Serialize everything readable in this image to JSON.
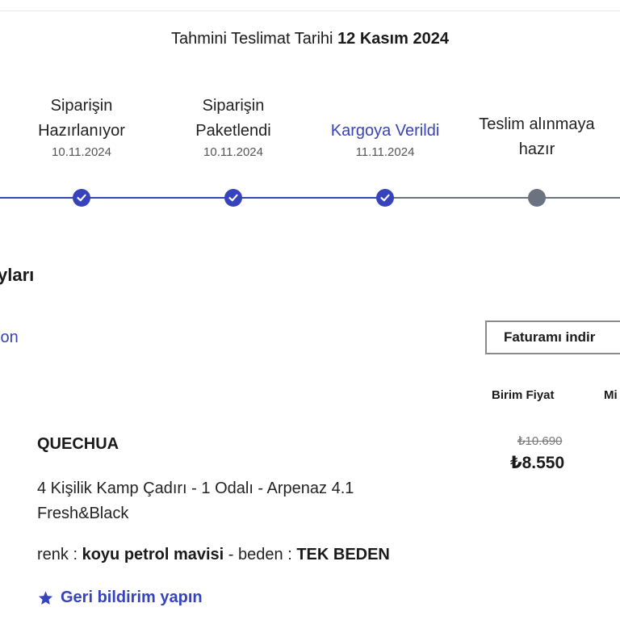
{
  "delivery": {
    "label": "Tahmini Teslimat Tarihi",
    "date": "12 Kasım 2024"
  },
  "steps": [
    {
      "title": "Siparişin\nHazırlanıyor",
      "date": "10.11.2024",
      "status": "done"
    },
    {
      "title": "Siparişin\nPaketlendi",
      "date": "10.11.2024",
      "status": "done"
    },
    {
      "title": "Kargoya Verildi",
      "date": "11.11.2024",
      "status": "done-active"
    },
    {
      "title": "Teslim alınmaya\nhazır",
      "date": "",
      "status": "pending"
    }
  ],
  "colors": {
    "accent": "#3643ba",
    "pending": "#6b7280",
    "track_done": "#3643ba",
    "track_pending": "#6b7280"
  },
  "section": {
    "title_fragment": "yları",
    "link_fragment": "lon"
  },
  "invoice_button": "Faturamı indir",
  "table": {
    "unit_price_header": "Birim Fiyat",
    "next_header_fragment": "Mi"
  },
  "product": {
    "brand": "QUECHUA",
    "name": "4 Kişilik Kamp Çadırı - 1 Odalı - Arpenaz 4.1 Fresh&Black",
    "color_label": "renk :",
    "color_value": "koyu petrol mavisi",
    "separator": "-",
    "size_label": "beden :",
    "size_value": "TEK BEDEN",
    "old_price": "₺10.690",
    "price": "₺8.550"
  },
  "feedback_link": "Geri bildirim yapın",
  "icons": {
    "check": "check-icon",
    "star": "star-icon"
  }
}
